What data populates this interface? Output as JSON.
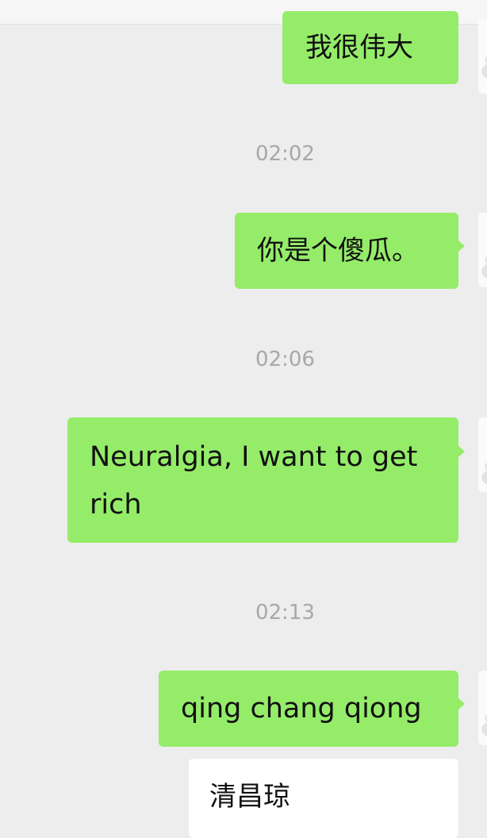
{
  "messages": [
    {
      "text": "我很伟大"
    },
    {
      "text": "你是个傻瓜。"
    },
    {
      "text": "Neuralgia, I want to get rich"
    },
    {
      "text": "qing chang qiong"
    },
    {
      "text": "清昌琼"
    }
  ],
  "timestamps": [
    "02:02",
    "02:06",
    "02:13"
  ],
  "colors": {
    "background": "#ededed",
    "sent_bubble": "#95ec69",
    "received_bubble": "#ffffff",
    "timestamp_text": "#a8a8a8"
  },
  "icons": {
    "avatar": "user-avatar-icon"
  }
}
